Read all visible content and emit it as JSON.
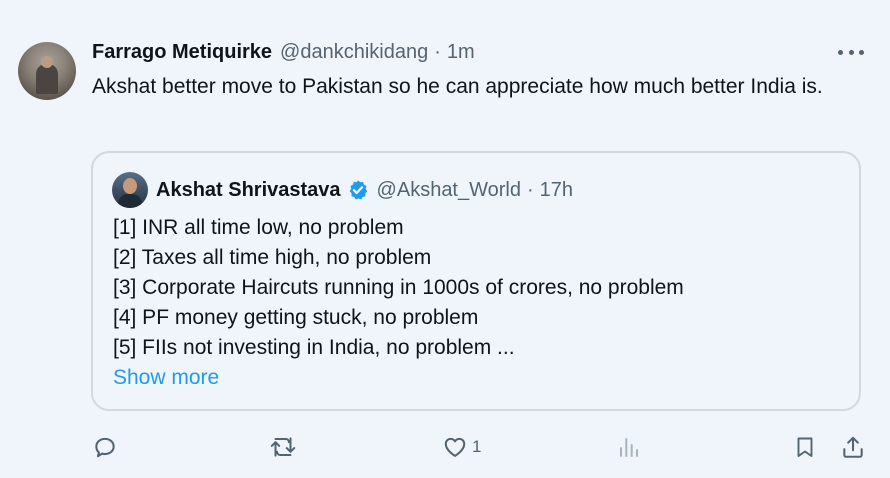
{
  "tweet": {
    "author_name": "Farrago Metiquirke",
    "handle": "@dankchikidang",
    "separator": "·",
    "time": "1m",
    "text": "Akshat better move to Pakistan so he can appreciate how much better India is."
  },
  "quote": {
    "author_name": "Akshat Shrivastava",
    "verified": true,
    "handle": "@Akshat_World",
    "separator": "·",
    "time": "17h",
    "lines": [
      "[1] INR all time low, no problem",
      "[2] Taxes all time high, no problem",
      "[3] Corporate Haircuts running in 1000s of crores, no problem",
      "[4] PF money getting stuck, no problem",
      "[5] FIIs not investing in India, no problem ..."
    ],
    "show_more": "Show more"
  },
  "actions": {
    "reply_icon": "reply-icon",
    "retweet_icon": "retweet-icon",
    "like_icon": "heart-icon",
    "like_count": "1",
    "views_icon": "views-icon",
    "bookmark_icon": "bookmark-icon",
    "share_icon": "share-icon"
  },
  "colors": {
    "background": "#f0f5fb",
    "text": "#0f1419",
    "muted": "#536471",
    "link": "#1d9bf0",
    "border": "#cfd9de"
  }
}
